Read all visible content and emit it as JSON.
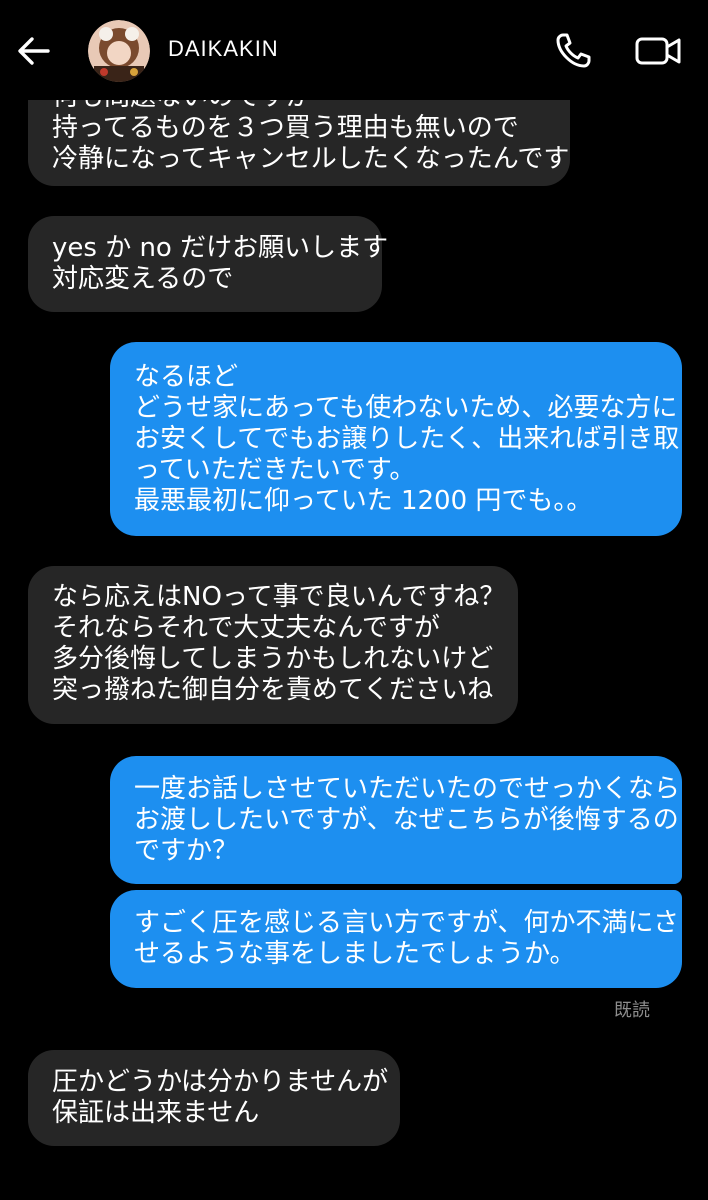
{
  "header": {
    "contact_name": "DAIKAKIN",
    "icons": {
      "back": "arrow-left-icon",
      "call": "phone-icon",
      "video": "video-camera-icon"
    }
  },
  "colors": {
    "background": "#000000",
    "incoming_bubble": "#262626",
    "outgoing_bubble": "#1d8ff0",
    "read_receipt": "#8e8e8e"
  },
  "messages": [
    {
      "from": "them",
      "lines": [
        "何も問題ないのですが",
        "持ってるものを３つ買う理由も無いので",
        "冷静になってキャンセルしたくなったんです"
      ]
    },
    {
      "from": "them",
      "lines": [
        "yes か no だけお願いします",
        "対応変えるので"
      ]
    },
    {
      "from": "me",
      "lines": [
        "なるほど",
        "どうせ家にあっても使わないため、必要な方に",
        "お安くしてでもお譲りしたく、出来れば引き取",
        "っていただきたいです。",
        "最悪最初に仰っていた 1200 円でも。。"
      ]
    },
    {
      "from": "them",
      "lines": [
        "なら応えはNOって事で良いんですね？",
        "それならそれで大丈夫なんですが",
        "多分後悔してしまうかもしれないけど",
        "突っ撥ねた御自分を責めてくださいね"
      ]
    },
    {
      "from": "me",
      "lines": [
        "一度お話しさせていただいたのでせっかくなら",
        "お渡ししたいですが、なぜこちらが後悔するの",
        "ですか？"
      ]
    },
    {
      "from": "me",
      "lines": [
        "すごく圧を感じる言い方ですが、何か不満にさ",
        "せるような事をしましたでしょうか。"
      ]
    },
    {
      "from": "them",
      "lines": [
        "圧かどうかは分かりませんが",
        "保証は出来ません"
      ]
    }
  ],
  "read_receipt": "既読"
}
